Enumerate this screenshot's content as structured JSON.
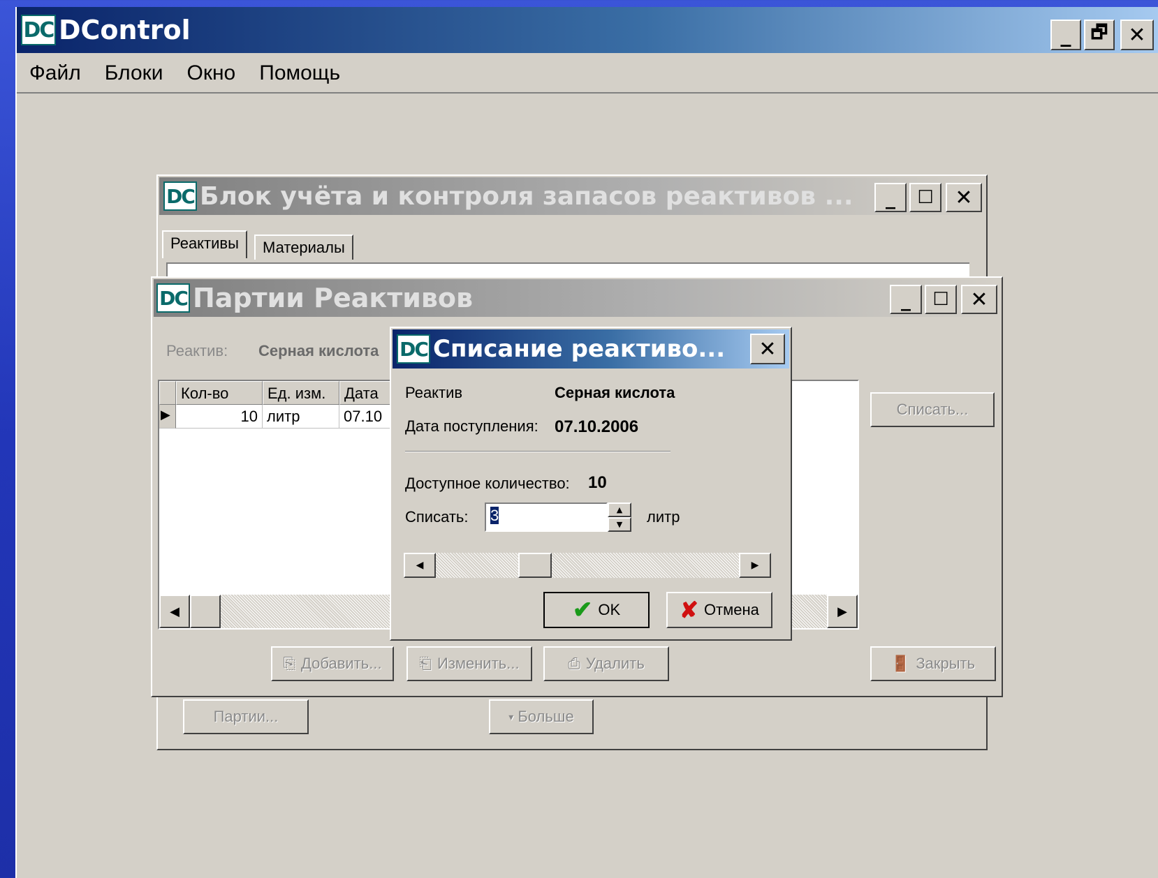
{
  "app": {
    "logo": "DC",
    "title": "DControl",
    "controls": {
      "minimize": "_",
      "restore": "🗗",
      "close": "✕"
    }
  },
  "menu": [
    "Файл",
    "Блоки",
    "Окно",
    "Помощь"
  ],
  "block_window": {
    "logo": "DC",
    "title": "Блок учёта и контроля запасов реактивов ...",
    "tabs": [
      "Реактивы",
      "Материалы"
    ],
    "buttons": {
      "parties": "Партии...",
      "more": "Больше"
    }
  },
  "parties_window": {
    "logo": "DC",
    "title": "Партии Реактивов",
    "reagent_label": "Реактив:",
    "reagent_value": "Серная кислота",
    "table": {
      "columns": [
        "Кол-во",
        "Ед. изм.",
        "Дата"
      ],
      "rows": [
        {
          "qty": "10",
          "unit": "литр",
          "date": "07.10"
        }
      ]
    },
    "buttons": {
      "write_off": "Списать...",
      "add": "Добавить...",
      "edit": "Изменить...",
      "delete": "Удалить",
      "close": "Закрыть"
    }
  },
  "writeoff_dialog": {
    "logo": "DC",
    "title": "Списание реактиво...",
    "reagent_label": "Реактив",
    "reagent_value": "Серная кислота",
    "date_label": "Дата поступления:",
    "date_value": "07.10.2006",
    "available_label": "Доступное количество:",
    "available_value": "10",
    "writeoff_label": "Списать:",
    "writeoff_value": "3",
    "unit": "литр",
    "ok": "OK",
    "cancel": "Отмена"
  }
}
